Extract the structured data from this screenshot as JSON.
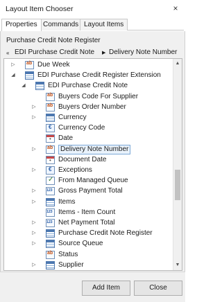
{
  "window": {
    "title": "Layout Item Chooser",
    "close_glyph": "×"
  },
  "tabs": [
    {
      "label": "Properties",
      "active": true
    },
    {
      "label": "Commands",
      "active": false
    },
    {
      "label": "Layout Items",
      "active": false
    }
  ],
  "context_label": "Purchase Credit Note Register",
  "breadcrumb": {
    "back_glyph": "«",
    "items": [
      "EDI Purchase Credit Note",
      "Delivery Note Number"
    ],
    "separator_glyph": "▶"
  },
  "tree": {
    "rows": [
      {
        "label": "Due Week",
        "icon": "text-field-icon",
        "expander": "expand",
        "indent": 0
      },
      {
        "label": "EDI Purchase Credit Register Extension",
        "icon": "table-icon",
        "expander": "collapse",
        "indent": 0
      },
      {
        "label": "EDI Purchase Credit Note",
        "icon": "table-icon",
        "expander": "collapse",
        "indent": 1
      },
      {
        "label": "Buyers Code For Supplier",
        "icon": "text-field-icon",
        "expander": "none",
        "indent": 2
      },
      {
        "label": "Buyers Order Number",
        "icon": "text-field-icon",
        "expander": "expand",
        "indent": 2
      },
      {
        "label": "Currency",
        "icon": "table-icon",
        "expander": "expand",
        "indent": 2
      },
      {
        "label": "Currency Code",
        "icon": "currency-icon",
        "expander": "none",
        "indent": 2
      },
      {
        "label": "Date",
        "icon": "date-icon",
        "expander": "none",
        "indent": 2
      },
      {
        "label": "Delivery Note Number",
        "icon": "text-field-icon",
        "expander": "expand",
        "indent": 2,
        "selected": true
      },
      {
        "label": "Document Date",
        "icon": "date-icon",
        "expander": "none",
        "indent": 2
      },
      {
        "label": "Exceptions",
        "icon": "currency-icon",
        "expander": "expand",
        "indent": 2
      },
      {
        "label": "From Managed Queue",
        "icon": "checkbox-icon",
        "expander": "none",
        "indent": 2
      },
      {
        "label": "Gross Payment Total",
        "icon": "number-icon",
        "expander": "expand",
        "indent": 2
      },
      {
        "label": "Items",
        "icon": "table-icon",
        "expander": "expand",
        "indent": 2
      },
      {
        "label": "Items - Item Count",
        "icon": "number-icon",
        "expander": "none",
        "indent": 2
      },
      {
        "label": "Net Payment Total",
        "icon": "number-icon",
        "expander": "expand",
        "indent": 2
      },
      {
        "label": "Purchase Credit Note Register",
        "icon": "table-icon",
        "expander": "expand",
        "indent": 2
      },
      {
        "label": "Source Queue",
        "icon": "table-icon",
        "expander": "expand",
        "indent": 2
      },
      {
        "label": "Status",
        "icon": "text-field-icon",
        "expander": "none",
        "indent": 2
      },
      {
        "label": "Supplier",
        "icon": "table-icon",
        "expander": "expand",
        "indent": 2
      }
    ],
    "glyphs": {
      "expand": "▷",
      "collapse": "◢",
      "scroll_up": "▲",
      "scroll_down": "▼"
    }
  },
  "buttons": {
    "add": "Add Item",
    "close": "Close"
  }
}
